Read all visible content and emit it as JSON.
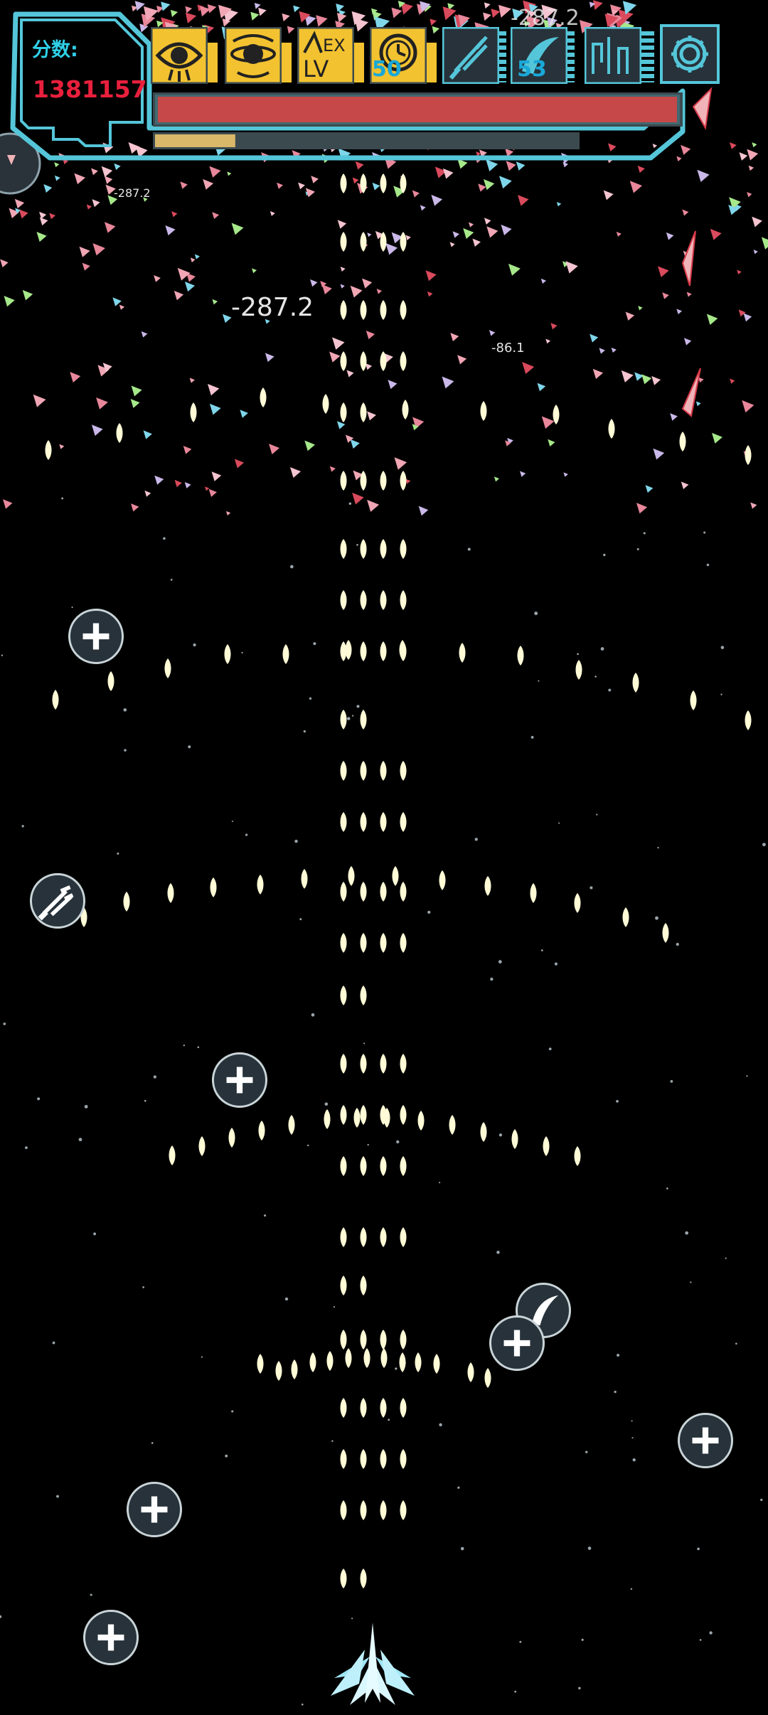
{
  "hud": {
    "score_label": "分数:",
    "score_value": "1381157",
    "health_percent": 100,
    "energy_percent": 19,
    "colors": {
      "frame": "#55c6d9",
      "health": "#c64848",
      "energy": "#d9b86a",
      "skill_active_bg": "#f2c230",
      "score_value": "#e8203c"
    }
  },
  "skills": [
    {
      "icon": "eye-skill-icon",
      "state": "active"
    },
    {
      "icon": "planet-skill-icon",
      "state": "active"
    },
    {
      "icon": "ex-level-icon",
      "label": "EX LV",
      "state": "active"
    },
    {
      "icon": "clock-skill-icon",
      "state": "active",
      "count": "50"
    },
    {
      "icon": "sword-weapon-icon",
      "state": "inactive"
    },
    {
      "icon": "crescent-blade-icon",
      "state": "inactive",
      "count": "53"
    },
    {
      "icon": "circuit-weapon-icon",
      "state": "inactive"
    },
    {
      "icon": "gear-icon",
      "state": "settings"
    }
  ],
  "damage_numbers": [
    "-287.2",
    "-287.2",
    "-86.1",
    "-287.2"
  ],
  "pickups": [
    {
      "icon": "plus-icon"
    },
    {
      "icon": "sword-upgrade-icon"
    },
    {
      "icon": "plus-icon"
    },
    {
      "icon": "crescent-icon"
    },
    {
      "icon": "plus-icon"
    },
    {
      "icon": "plus-icon"
    },
    {
      "icon": "plus-icon"
    },
    {
      "icon": "plus-icon"
    }
  ]
}
